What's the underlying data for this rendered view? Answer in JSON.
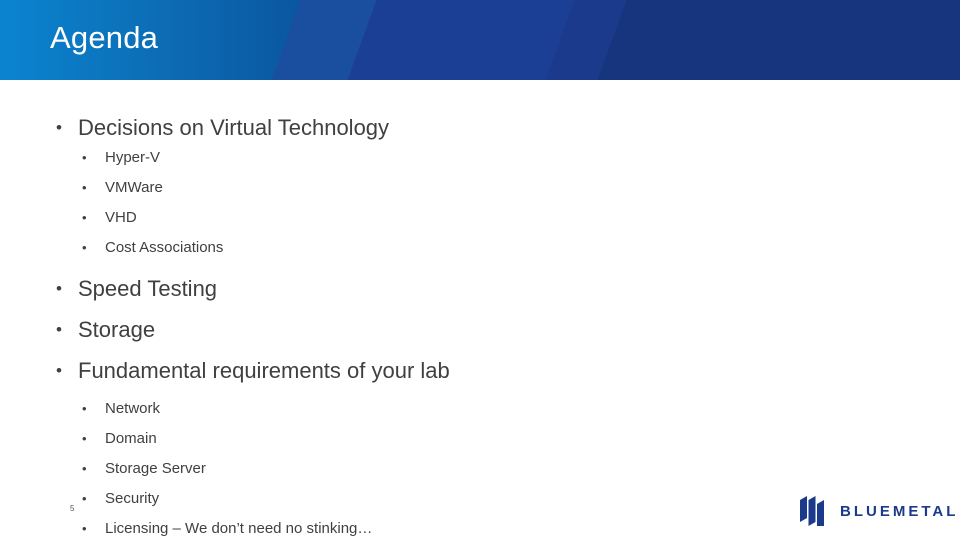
{
  "slide": {
    "title": "Agenda",
    "page_number": "5",
    "header_color": "#1b3a8c",
    "header_accent_color": "#0b84d0",
    "text_color": "#404040"
  },
  "outline": [
    {
      "level": 1,
      "bullet": "•",
      "text": "Decisions on Virtual Technology",
      "children": [
        {
          "level": 2,
          "bullet": "•",
          "text": "Hyper-V"
        },
        {
          "level": 2,
          "bullet": "•",
          "text": "VMWare"
        },
        {
          "level": 2,
          "bullet": "•",
          "text": "VHD"
        },
        {
          "level": 2,
          "bullet": "•",
          "text": "Cost Associations"
        }
      ]
    },
    {
      "level": 1,
      "bullet": "•",
      "text": "Speed Testing",
      "children": []
    },
    {
      "level": 1,
      "bullet": "•",
      "text": "Storage",
      "children": []
    },
    {
      "level": 1,
      "bullet": "•",
      "text": "Fundamental requirements of your lab",
      "children": [
        {
          "level": 2,
          "bullet": "•",
          "text": "Network"
        },
        {
          "level": 2,
          "bullet": "•",
          "text": "Domain"
        },
        {
          "level": 2,
          "bullet": "•",
          "text": "Storage Server"
        },
        {
          "level": 2,
          "bullet": "•",
          "text": "Security"
        },
        {
          "level": 2,
          "bullet": "•",
          "text": "Licensing – We don’t need no stinking…"
        }
      ]
    }
  ],
  "logo": {
    "text": "BLUEMETAL",
    "mark_color": "#1b3a8c"
  }
}
